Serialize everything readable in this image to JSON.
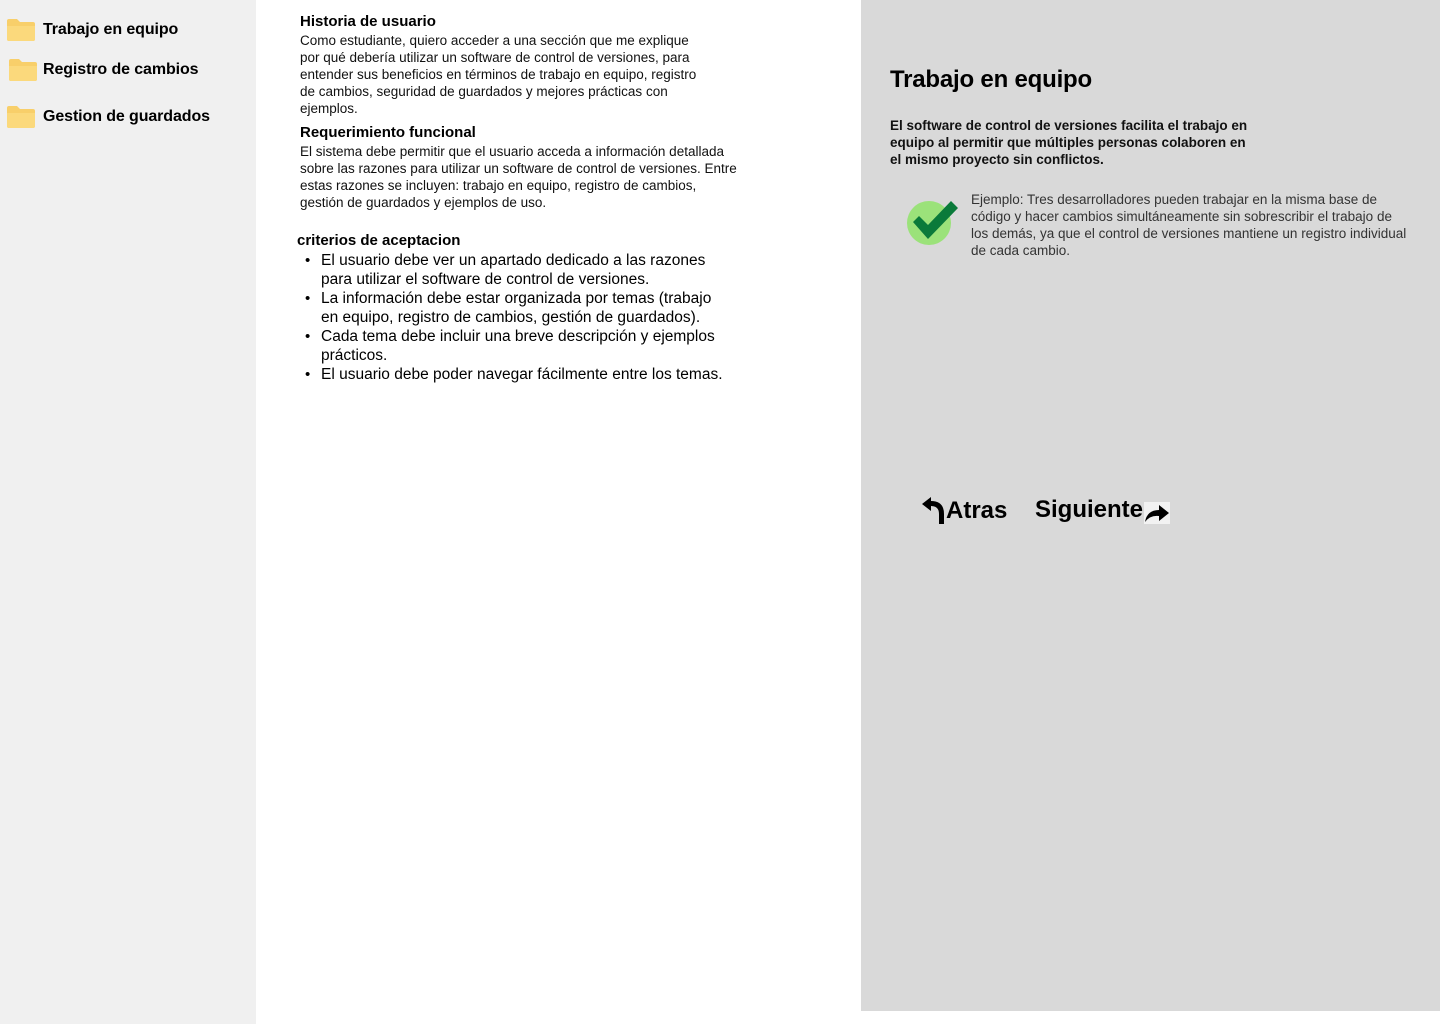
{
  "sidebar": {
    "items": [
      {
        "label": "Trabajo en equipo",
        "icon": "folder-icon"
      },
      {
        "label": "Registro de cambios",
        "icon": "folder-icon"
      },
      {
        "label": "Gestion de guardados",
        "icon": "folder-icon"
      }
    ]
  },
  "story": {
    "title": "Historia de usuario",
    "body": "Como estudiante, quiero acceder a una sección que me explique por qué debería utilizar un software de control de versiones, para entender sus beneficios en términos de trabajo en equipo, registro de cambios, seguridad de guardados y mejores prácticas con ejemplos."
  },
  "requirement": {
    "title": "Requerimiento funcional",
    "body": "El sistema debe permitir que el usuario acceda a información detallada sobre las razones para utilizar un software de control de versiones. Entre estas razones se incluyen: trabajo en equipo, registro de cambios, gestión de guardados y ejemplos de uso."
  },
  "criteria": {
    "title": "criterios de aceptacion",
    "items": [
      "El usuario debe ver un apartado dedicado a las razones para utilizar el software de control de versiones.",
      "La información debe estar organizada por temas (trabajo en equipo, registro de cambios, gestión de guardados).",
      "Cada tema debe incluir una breve descripción y ejemplos prácticos.",
      "El usuario debe poder navegar fácilmente entre los temas."
    ]
  },
  "detail": {
    "title": "Trabajo en equipo",
    "description": "El software de control de versiones facilita el trabajo en equipo al permitir que múltiples personas colaboren en el mismo proyecto sin conflictos.",
    "example_icon": "checkmark-icon",
    "example": "Ejemplo: Tres desarrolladores pueden trabajar en la misma base de código y hacer cambios simultáneamente sin sobrescribir el trabajo de los demás, ya que el control de versiones mantiene un registro individual de cada cambio."
  },
  "navigation": {
    "back_label": "Atras",
    "next_label": "Siguiente"
  },
  "colors": {
    "sidebar_bg": "#f0f0f0",
    "panel_bg": "#d9d9d9",
    "folder": "#f8cf6a",
    "check_green": "#0a7a3a",
    "check_circle": "#9be27a"
  }
}
